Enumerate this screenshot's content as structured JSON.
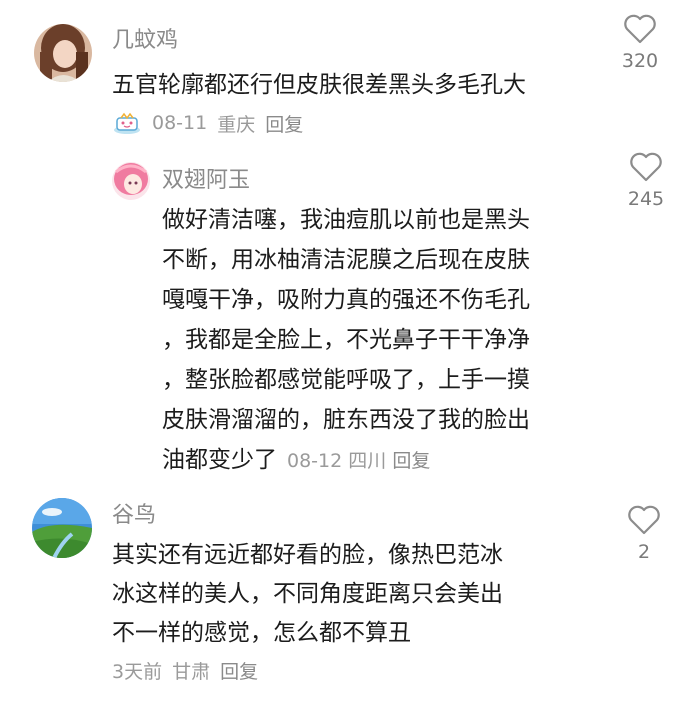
{
  "comments": [
    {
      "author": "几蚊鸡",
      "text": "五官轮廓都还行但皮肤很差黑头多毛孔大",
      "date": "08-11",
      "location": "重庆",
      "reply": "回复",
      "likes": "320"
    },
    {
      "author": "双翅阿玉",
      "text": "做好清洁噻，我油痘肌以前也是黑头\n不断，用冰柚清洁泥膜之后现在皮肤\n嘎嘎干净，吸附力真的强还不伤毛孔\n，我都是全脸上，不光鼻子干干净净\n，整张脸都感觉能呼吸了，上手一摸\n皮肤滑溜溜的，脏东西没了我的脸出\n油都变少了",
      "date": "08-12",
      "location": "四川",
      "reply": "回复",
      "likes": "245"
    },
    {
      "author": "谷鸟",
      "text": "其实还有远近都好看的脸，像热巴范冰\n冰这样的美人，不同角度距离只会美出\n不一样的感觉，怎么都不算丑",
      "date": "3天前",
      "location": "甘肃",
      "reply": "回复",
      "likes": "2"
    }
  ],
  "colors": {
    "name": "#8a8a8a",
    "text": "#1c1c1c",
    "meta": "#9a9a9a",
    "like_stroke": "#8c8c8c"
  }
}
